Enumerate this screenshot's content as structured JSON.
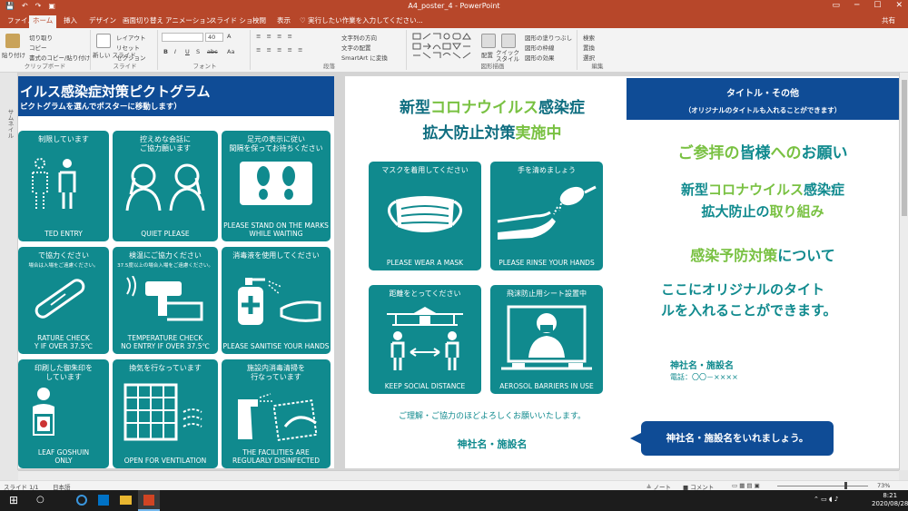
{
  "titlebar": {
    "title": "A4_poster_4 - PowerPoint",
    "qat_save": "💾",
    "qat_undo": "↶",
    "qat_redo": "↷",
    "qat_more": "▣",
    "ribbon_opt": "▭",
    "min": "─",
    "max": "☐",
    "close": "✕"
  },
  "tabs": [
    {
      "label": "ファイル"
    },
    {
      "label": "ホーム"
    },
    {
      "label": "挿入"
    },
    {
      "label": "デザイン"
    },
    {
      "label": "画面切り替え"
    },
    {
      "label": "アニメーション"
    },
    {
      "label": "スライド ショー"
    },
    {
      "label": "校閲"
    },
    {
      "label": "表示"
    }
  ],
  "tellme": "♡ 実行したい作業を入力してください...",
  "share": "共有",
  "ribbon": {
    "clipboard": {
      "label": "クリップボード",
      "paste": "貼り付け",
      "cut": "切り取り",
      "copy": "コピー",
      "format_copy": "書式のコピー/貼り付け"
    },
    "slides": {
      "label": "スライド",
      "new_slide": "新しい スライド",
      "layout": "レイアウト",
      "reset": "リセット",
      "section": "セクション"
    },
    "font": {
      "label": "フォント",
      "size": "40",
      "bold": "B",
      "italic": "I",
      "underline": "U",
      "strike": "S",
      "shadow": "abc",
      "aa": "Aa",
      "color_a": "A"
    },
    "paragraph": {
      "label": "段落",
      "text_dir": "文字列の方向",
      "align_text": "文字の配置",
      "smartart": "SmartArt に変換"
    },
    "drawing": {
      "label": "図形描画",
      "arrange": "配置",
      "quick_style": "クイック スタイル",
      "fill": "図形の塗りつぶし",
      "outline": "図形の枠線",
      "effect": "図形の効果"
    },
    "editing": {
      "label": "編集",
      "find": "検索",
      "replace": "置換",
      "select": "選択"
    }
  },
  "thumbbar": {
    "label": "サムネイル"
  },
  "left_slide": {
    "title": "イルス感染症対策ピクトグラム",
    "subtitle": "ピクトグラムを選んでポスターに移動します）",
    "tiles": [
      {
        "top": "制限しています",
        "bottom": "TED ENTRY"
      },
      {
        "top": "控えめな会話に\nご協力願います",
        "bottom": "QUIET PLEASE"
      },
      {
        "top": "足元の表示に従い\n間隔を保ってお待ちください",
        "bottom": "PLEASE STAND ON THE MARKS\nWHILE WAITING"
      },
      {
        "top": "で協力ください",
        "top2": "場合は入場をご遠慮ください。",
        "bottom": "RATURE CHECK\nY IF OVER 37.5℃"
      },
      {
        "top": "検温にご協力ください",
        "top2": "37.5度以上の場合入場をご遠慮ください。",
        "bottom": "TEMPERATURE CHECK\nNO ENTRY IF OVER 37.5℃"
      },
      {
        "top": "消毒液を使用してください",
        "bottom": "PLEASE SANITISE YOUR HANDS"
      },
      {
        "top": "印刷した御朱印を\nしています",
        "bottom": "LEAF GOSHUIN\nONLY"
      },
      {
        "top": "換気を行なっています",
        "bottom": "OPEN FOR VENTILATION"
      },
      {
        "top": "施設内消毒清掃を\n行なっています",
        "bottom": "THE FACILITIES ARE\nREGULARLY DISINFECTED"
      }
    ]
  },
  "center_slide": {
    "title_line1_a": "新型",
    "title_line1_b": "コロナウイルス",
    "title_line1_c": "感染症",
    "title_line2_a": "拡大防止対策",
    "title_line2_b": "実施中",
    "tiles": [
      {
        "top": "マスクを着用してください",
        "bottom": "PLEASE WEAR A MASK"
      },
      {
        "top": "手を清めましょう",
        "bottom": "PLEASE RINSE YOUR HANDS"
      },
      {
        "top": "距離をとってください",
        "bottom": "KEEP SOCIAL DISTANCE"
      },
      {
        "top": "飛沫防止用シート設置中",
        "bottom": "AEROSOL BARRIERS IN USE"
      }
    ],
    "footer1": "ご理解・ご協力のほどよろしくお願いいたします。",
    "footer2": "神社名・施設名"
  },
  "right_slide": {
    "title": "タイトル・その他",
    "subtitle": "（オリジナルのタイトルも入れることができます）",
    "t1_a": "ご参拝の",
    "t1_b": "皆様",
    "t1_c": "への",
    "t1_d": "お願い",
    "t2_a": "新型",
    "t2_b": "コロナウイルス",
    "t2_c": "感染症",
    "t3_a": "拡大防止の",
    "t3_b": "取り組み",
    "t4_a": "感染予防対策",
    "t4_b": "について",
    "t5_1": "ここにオリジナルのタイト",
    "t5_2": "ルを入れることができます。",
    "t6": "神社名・施設名",
    "t7": "電話：〇〇－××××"
  },
  "callout": "神社名・施設名をいれましょう。",
  "status": {
    "slide": "スライド 1/1",
    "lang": "日本語",
    "notes": "≜ ノート",
    "comments": "■ コメント",
    "zoom": "73%"
  },
  "taskbar": {
    "start": "⊞",
    "search": "○",
    "time": "8:21",
    "date": "2020/08/28"
  },
  "colors": {
    "accent": "#b7472a",
    "teal": "#108a8e",
    "navy": "#0f4c96",
    "green": "#79c142"
  }
}
